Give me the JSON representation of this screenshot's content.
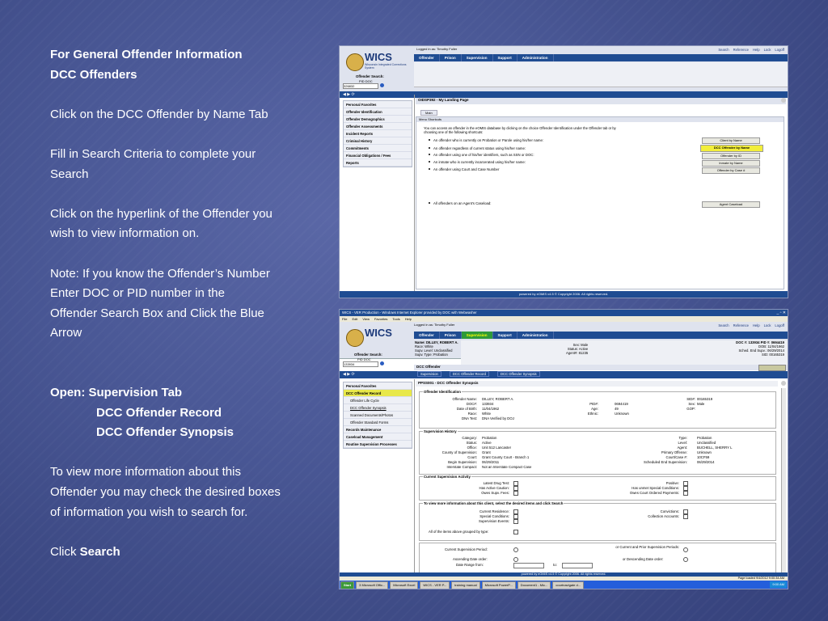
{
  "notes": [
    {
      "text": "For General Offender Information",
      "bold": true
    },
    {
      "text": "DCC Offenders",
      "bold": true
    },
    {
      "text": ""
    },
    {
      "text": "Click on the DCC Offender by Name Tab"
    },
    {
      "text": ""
    },
    {
      "text": "Fill in Search Criteria to complete your"
    },
    {
      "text": "Search"
    },
    {
      "text": ""
    },
    {
      "text": "Click on the hyperlink of the Offender you"
    },
    {
      "text": "wish to view information on."
    },
    {
      "text": ""
    },
    {
      "text": "Note: If you know the Offender’s Number"
    },
    {
      "text": "Enter DOC or PID number in the"
    },
    {
      "text": "Offender Search Box and Click the Blue"
    },
    {
      "text": "Arrow"
    },
    {
      "text": ""
    },
    {
      "text": ""
    },
    {
      "text": "Open:  Supervision Tab",
      "bold": true
    },
    {
      "text": "DCC Offender Record",
      "bold": true,
      "indent": true
    },
    {
      "text": "DCC Offender Synopsis",
      "bold": true,
      "indent": true
    },
    {
      "text": ""
    },
    {
      "text": "To view more information about this"
    },
    {
      "text": "Offender you may check the desired boxes"
    },
    {
      "text": "of information you wish to search for."
    },
    {
      "text": ""
    },
    {
      "text": "Click ",
      "suffix_bold": "Search"
    }
  ],
  "s1": {
    "logged_in": "Logged in as: Timothy Fuller",
    "app": "WICS",
    "app_sub": "Wisconsin Integrated Corrections System",
    "toplinks": [
      "Search",
      "Reference",
      "Help",
      "Lock",
      "Logoff"
    ],
    "tabs": [
      "Offender",
      "Prison",
      "Supervision",
      "Support",
      "Administration"
    ],
    "search_label": "Offender Search:",
    "search_opts": "PID  DOC",
    "search_value": "326832",
    "leftnav": [
      "Personal Favorites",
      "Offender Identification",
      "Offender Demographics",
      "Offender Assessments",
      "Incident Reports",
      "Criminal History",
      "Commitments",
      "Financial Obligations / Fees",
      "Reports"
    ],
    "page_title": "OIDSP392 - My Landing Page",
    "subtab": "Main",
    "section": "Menu Shortcuts",
    "intro": "You can access an offender in the eOMIS database by clicking on the choice Offender Identification under the Offender tab or by choosing one of the following shortcuts:",
    "options": [
      "An offender who is currently on Probation or Parole using his/her name:",
      "An offender regardless of current status using his/her name:",
      "An offender using one of his/her identifiers, such as SSN or DOC:",
      "An inmate who is currently incarcerated using his/her name:",
      "An offender using Court and Case Number",
      "All offenders on an Agent's Caseload:"
    ],
    "buttons": [
      "Client by Name",
      "DCC Offender by Name",
      "Offender by ID",
      "Inmate by Name",
      "Offender by Case #",
      "Agent Caseload"
    ],
    "footer": "powered by eOMIS v4.5 © Copyright 2006. All rights reserved."
  },
  "s2": {
    "window_title": "WICS - VER Production - Windows Internet Explorer provided by DOC with Webwasher",
    "menu": [
      "File",
      "Edit",
      "View",
      "Favorites",
      "Tools",
      "Help"
    ],
    "logged_in": "Logged in as: Timothy Fuller",
    "app": "WICS",
    "toplinks": [
      "Search",
      "Reference",
      "Help",
      "Lock",
      "Logoff"
    ],
    "tabs": [
      "Offender",
      "Prison",
      "Supervision",
      "Support",
      "Administration"
    ],
    "header_left": [
      "Name: DILLEY, ROBERT A.",
      "Race: White",
      "Supv. Level: Unclassified",
      "Supv. Type: Probation"
    ],
    "header_mid": [
      "Sex: Male",
      "Status: Active",
      "Agent#: 81235"
    ],
    "header_right": [
      "DOC #: 133934  PID #: 0694419",
      "DOB: 11/04/1962",
      "Sched. End Supv.: 06/29/2014",
      "SID: 00165319"
    ],
    "crumb_title": "DCC Offender",
    "crumbs": [
      "Supervision",
      "DCC Offender Record",
      "DCC Offender Synopsis"
    ],
    "search_label": "Offender Search:",
    "search_opts": "PID  DOC",
    "search_value": "133934",
    "leftnav": [
      "Personal Favorites",
      "DCC Offender Record",
      "Offender Life Cycle",
      "DCC Offender Synopsis",
      "Scanned Documents/Photos",
      "Offender Standard Forms",
      "Records Maintenance",
      "Caseload Management",
      "Routine Supervision Processes"
    ],
    "page_title": "PPSS001 - DCC Offender Synopsis",
    "ident_title": "Offender Identification",
    "ident_left": [
      [
        "Offender Name:",
        "DILLEY, ROBERT A."
      ],
      [
        "DOC#:",
        "133934"
      ],
      [
        "Date of Birth:",
        "11/04/1962"
      ],
      [
        "Race:",
        "White"
      ],
      [
        "DNA Test:",
        "DNA Verified by DOJ"
      ]
    ],
    "ident_mid": [
      [
        "PID#:",
        "0694419"
      ],
      [
        "Age:",
        "49"
      ],
      [
        "Ethnic:",
        "Unknown"
      ]
    ],
    "ident_right": [
      [
        "SID#:",
        "00165319"
      ],
      [
        "Sex:",
        "Male"
      ],
      [
        "GOP:",
        ""
      ]
    ],
    "hist_title": "Supervision History",
    "hist_left": [
      [
        "Category:",
        "Probation"
      ],
      [
        "Status:",
        "Active"
      ],
      [
        "Office:",
        "Unit 512 Lancaster"
      ],
      [
        "County of Supervision:",
        "Grant"
      ],
      [
        "Court:",
        "Grant County Court - Branch 1"
      ],
      [
        "Begin Supervision:",
        "06/29/2011"
      ],
      [
        "Interstate Compact:",
        "Not an Interstate Compact Case"
      ]
    ],
    "hist_right": [
      [
        "Type:",
        "Probation"
      ],
      [
        "Level:",
        "Unclassified"
      ],
      [
        "Agent:",
        "BUCHELL, SHERRY L"
      ],
      [
        "Primary Offense:",
        "Unknown"
      ],
      [
        "Court/Case #:",
        "10CF59"
      ],
      [
        "Scheduled End Supervision:",
        "06/29/2014"
      ]
    ],
    "act_title": "Current Supervision Activity",
    "act_left": [
      "Latest Drug Test:",
      "Has Active Caution:",
      "Owes Supv. Fees:"
    ],
    "act_right": [
      "Positive:",
      "Has unmet Special Conditions:",
      "Owes Court Ordered Payments:"
    ],
    "more_title": "To view more information about this client, select the desired items and click Search",
    "more_left": [
      "Current Residence:",
      "Special Conditions:",
      "Supervision Events:"
    ],
    "more_right": [
      "Convictions:",
      "Collection Accounts:"
    ],
    "more_all": "All of the items above grouped by type:",
    "period_left": "Current Supervision Period:",
    "period_right": "or Current and Prior Supervision Periods:",
    "asc": "Ascending Date order:",
    "desc": "or Descending Date order:",
    "range": "Date Range from:",
    "to": "to:",
    "footer": "powered by eOMIS v4.5 © Copyright 2006. All rights reserved.",
    "page_loaded": "Page loaded 9/4/2012 9:00:34 AM",
    "taskbar": [
      "Start",
      "3 Microsoft Offic...",
      "Microsoft Excel",
      "WICS - VER P...",
      "training manual",
      "Microsoft PowerP...",
      "Document1 - Mic...",
      "courtnavigate d..."
    ],
    "clock": "9:00 AM"
  }
}
